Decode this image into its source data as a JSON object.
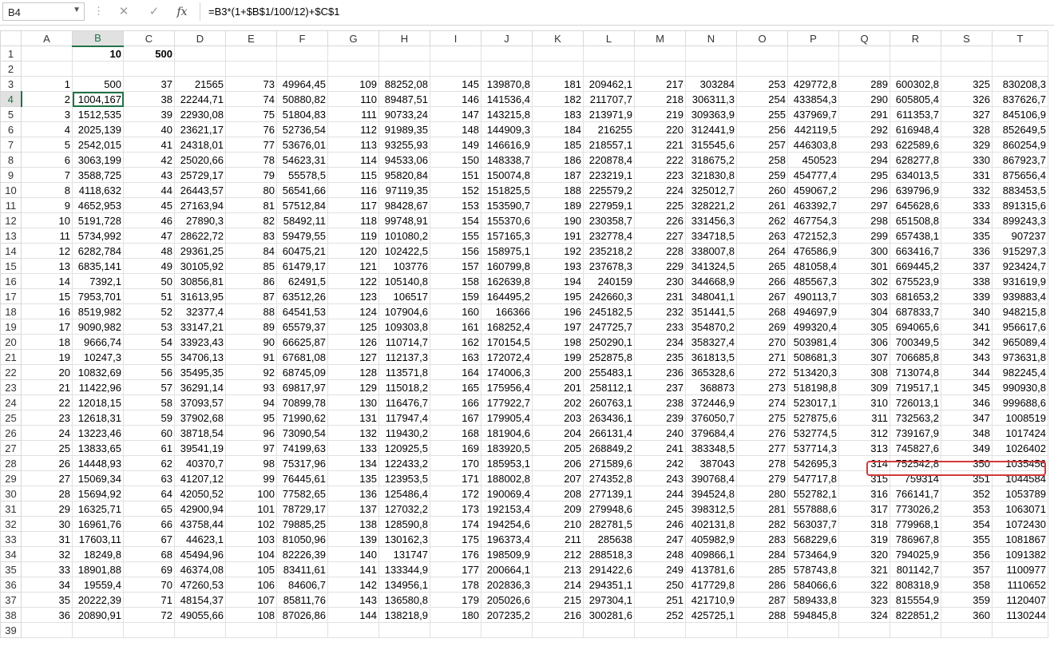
{
  "formula_bar": {
    "name_box": "B4",
    "cancel_glyph": "✕",
    "enter_glyph": "✓",
    "fx_label": "fx",
    "formula": "=B3*(1+$B$1/100/12)+$C$1"
  },
  "sheet": {
    "columns": [
      "A",
      "B",
      "C",
      "D",
      "E",
      "F",
      "G",
      "H",
      "I",
      "J",
      "K",
      "L",
      "M",
      "N",
      "O",
      "P",
      "Q",
      "R",
      "S",
      "T"
    ],
    "active_cell": "B4",
    "highlight": "Q25:T25",
    "rows": [
      {
        "n": "1",
        "cells": [
          "",
          "10",
          "500",
          "",
          "",
          "",
          "",
          "",
          "",
          "",
          "",
          "",
          "",
          "",
          "",
          "",
          "",
          "",
          "",
          ""
        ]
      },
      {
        "n": "2",
        "cells": [
          "",
          "",
          "",
          "",
          "",
          "",
          "",
          "",
          "",
          "",
          "",
          "",
          "",
          "",
          "",
          "",
          "",
          "",
          "",
          ""
        ]
      },
      {
        "n": "3",
        "cells": [
          "1",
          "500",
          "37",
          "21565",
          "73",
          "49964,45",
          "109",
          "88252,08",
          "145",
          "139870,8",
          "181",
          "209462,1",
          "217",
          "303284",
          "253",
          "429772,8",
          "289",
          "600302,8",
          "325",
          "830208,3"
        ]
      },
      {
        "n": "4",
        "cells": [
          "2",
          "1004,167",
          "38",
          "22244,71",
          "74",
          "50880,82",
          "110",
          "89487,51",
          "146",
          "141536,4",
          "182",
          "211707,7",
          "218",
          "306311,3",
          "254",
          "433854,3",
          "290",
          "605805,4",
          "326",
          "837626,7"
        ]
      },
      {
        "n": "5",
        "cells": [
          "3",
          "1512,535",
          "39",
          "22930,08",
          "75",
          "51804,83",
          "111",
          "90733,24",
          "147",
          "143215,8",
          "183",
          "213971,9",
          "219",
          "309363,9",
          "255",
          "437969,7",
          "291",
          "611353,7",
          "327",
          "845106,9"
        ]
      },
      {
        "n": "6",
        "cells": [
          "4",
          "2025,139",
          "40",
          "23621,17",
          "76",
          "52736,54",
          "112",
          "91989,35",
          "148",
          "144909,3",
          "184",
          "216255",
          "220",
          "312441,9",
          "256",
          "442119,5",
          "292",
          "616948,4",
          "328",
          "852649,5"
        ]
      },
      {
        "n": "7",
        "cells": [
          "5",
          "2542,015",
          "41",
          "24318,01",
          "77",
          "53676,01",
          "113",
          "93255,93",
          "149",
          "146616,9",
          "185",
          "218557,1",
          "221",
          "315545,6",
          "257",
          "446303,8",
          "293",
          "622589,6",
          "329",
          "860254,9"
        ]
      },
      {
        "n": "8",
        "cells": [
          "6",
          "3063,199",
          "42",
          "25020,66",
          "78",
          "54623,31",
          "114",
          "94533,06",
          "150",
          "148338,7",
          "186",
          "220878,4",
          "222",
          "318675,2",
          "258",
          "450523",
          "294",
          "628277,8",
          "330",
          "867923,7"
        ]
      },
      {
        "n": "9",
        "cells": [
          "7",
          "3588,725",
          "43",
          "25729,17",
          "79",
          "55578,5",
          "115",
          "95820,84",
          "151",
          "150074,8",
          "187",
          "223219,1",
          "223",
          "321830,8",
          "259",
          "454777,4",
          "295",
          "634013,5",
          "331",
          "875656,4"
        ]
      },
      {
        "n": "10",
        "cells": [
          "8",
          "4118,632",
          "44",
          "26443,57",
          "80",
          "56541,66",
          "116",
          "97119,35",
          "152",
          "151825,5",
          "188",
          "225579,2",
          "224",
          "325012,7",
          "260",
          "459067,2",
          "296",
          "639796,9",
          "332",
          "883453,5"
        ]
      },
      {
        "n": "11",
        "cells": [
          "9",
          "4652,953",
          "45",
          "27163,94",
          "81",
          "57512,84",
          "117",
          "98428,67",
          "153",
          "153590,7",
          "189",
          "227959,1",
          "225",
          "328221,2",
          "261",
          "463392,7",
          "297",
          "645628,6",
          "333",
          "891315,6"
        ]
      },
      {
        "n": "12",
        "cells": [
          "10",
          "5191,728",
          "46",
          "27890,3",
          "82",
          "58492,11",
          "118",
          "99748,91",
          "154",
          "155370,6",
          "190",
          "230358,7",
          "226",
          "331456,3",
          "262",
          "467754,3",
          "298",
          "651508,8",
          "334",
          "899243,3"
        ]
      },
      {
        "n": "13",
        "cells": [
          "11",
          "5734,992",
          "47",
          "28622,72",
          "83",
          "59479,55",
          "119",
          "101080,2",
          "155",
          "157165,3",
          "191",
          "232778,4",
          "227",
          "334718,5",
          "263",
          "472152,3",
          "299",
          "657438,1",
          "335",
          "907237"
        ]
      },
      {
        "n": "14",
        "cells": [
          "12",
          "6282,784",
          "48",
          "29361,25",
          "84",
          "60475,21",
          "120",
          "102422,5",
          "156",
          "158975,1",
          "192",
          "235218,2",
          "228",
          "338007,8",
          "264",
          "476586,9",
          "300",
          "663416,7",
          "336",
          "915297,3"
        ]
      },
      {
        "n": "15",
        "cells": [
          "13",
          "6835,141",
          "49",
          "30105,92",
          "85",
          "61479,17",
          "121",
          "103776",
          "157",
          "160799,8",
          "193",
          "237678,3",
          "229",
          "341324,5",
          "265",
          "481058,4",
          "301",
          "669445,2",
          "337",
          "923424,7"
        ]
      },
      {
        "n": "16",
        "cells": [
          "14",
          "7392,1",
          "50",
          "30856,81",
          "86",
          "62491,5",
          "122",
          "105140,8",
          "158",
          "162639,8",
          "194",
          "240159",
          "230",
          "344668,9",
          "266",
          "485567,3",
          "302",
          "675523,9",
          "338",
          "931619,9"
        ]
      },
      {
        "n": "17",
        "cells": [
          "15",
          "7953,701",
          "51",
          "31613,95",
          "87",
          "63512,26",
          "123",
          "106517",
          "159",
          "164495,2",
          "195",
          "242660,3",
          "231",
          "348041,1",
          "267",
          "490113,7",
          "303",
          "681653,2",
          "339",
          "939883,4"
        ]
      },
      {
        "n": "18",
        "cells": [
          "16",
          "8519,982",
          "52",
          "32377,4",
          "88",
          "64541,53",
          "124",
          "107904,6",
          "160",
          "166366",
          "196",
          "245182,5",
          "232",
          "351441,5",
          "268",
          "494697,9",
          "304",
          "687833,7",
          "340",
          "948215,8"
        ]
      },
      {
        "n": "19",
        "cells": [
          "17",
          "9090,982",
          "53",
          "33147,21",
          "89",
          "65579,37",
          "125",
          "109303,8",
          "161",
          "168252,4",
          "197",
          "247725,7",
          "233",
          "354870,2",
          "269",
          "499320,4",
          "305",
          "694065,6",
          "341",
          "956617,6"
        ]
      },
      {
        "n": "20",
        "cells": [
          "18",
          "9666,74",
          "54",
          "33923,43",
          "90",
          "66625,87",
          "126",
          "110714,7",
          "162",
          "170154,5",
          "198",
          "250290,1",
          "234",
          "358327,4",
          "270",
          "503981,4",
          "306",
          "700349,5",
          "342",
          "965089,4"
        ]
      },
      {
        "n": "21",
        "cells": [
          "19",
          "10247,3",
          "55",
          "34706,13",
          "91",
          "67681,08",
          "127",
          "112137,3",
          "163",
          "172072,4",
          "199",
          "252875,8",
          "235",
          "361813,5",
          "271",
          "508681,3",
          "307",
          "706685,8",
          "343",
          "973631,8"
        ]
      },
      {
        "n": "22",
        "cells": [
          "20",
          "10832,69",
          "56",
          "35495,35",
          "92",
          "68745,09",
          "128",
          "113571,8",
          "164",
          "174006,3",
          "200",
          "255483,1",
          "236",
          "365328,6",
          "272",
          "513420,3",
          "308",
          "713074,8",
          "344",
          "982245,4"
        ]
      },
      {
        "n": "23",
        "cells": [
          "21",
          "11422,96",
          "57",
          "36291,14",
          "93",
          "69817,97",
          "129",
          "115018,2",
          "165",
          "175956,4",
          "201",
          "258112,1",
          "237",
          "368873",
          "273",
          "518198,8",
          "309",
          "719517,1",
          "345",
          "990930,8"
        ]
      },
      {
        "n": "24",
        "cells": [
          "22",
          "12018,15",
          "58",
          "37093,57",
          "94",
          "70899,78",
          "130",
          "116476,7",
          "166",
          "177922,7",
          "202",
          "260763,1",
          "238",
          "372446,9",
          "274",
          "523017,1",
          "310",
          "726013,1",
          "346",
          "999688,6"
        ]
      },
      {
        "n": "25",
        "cells": [
          "23",
          "12618,31",
          "59",
          "37902,68",
          "95",
          "71990,62",
          "131",
          "117947,4",
          "167",
          "179905,4",
          "203",
          "263436,1",
          "239",
          "376050,7",
          "275",
          "527875,6",
          "311",
          "732563,2",
          "347",
          "1008519"
        ]
      },
      {
        "n": "26",
        "cells": [
          "24",
          "13223,46",
          "60",
          "38718,54",
          "96",
          "73090,54",
          "132",
          "119430,2",
          "168",
          "181904,6",
          "204",
          "266131,4",
          "240",
          "379684,4",
          "276",
          "532774,5",
          "312",
          "739167,9",
          "348",
          "1017424"
        ]
      },
      {
        "n": "27",
        "cells": [
          "25",
          "13833,65",
          "61",
          "39541,19",
          "97",
          "74199,63",
          "133",
          "120925,5",
          "169",
          "183920,5",
          "205",
          "268849,2",
          "241",
          "383348,5",
          "277",
          "537714,3",
          "313",
          "745827,6",
          "349",
          "1026402"
        ]
      },
      {
        "n": "28",
        "cells": [
          "26",
          "14448,93",
          "62",
          "40370,7",
          "98",
          "75317,96",
          "134",
          "122433,2",
          "170",
          "185953,1",
          "206",
          "271589,6",
          "242",
          "387043",
          "278",
          "542695,3",
          "314",
          "752542,8",
          "350",
          "1035456"
        ]
      },
      {
        "n": "29",
        "cells": [
          "27",
          "15069,34",
          "63",
          "41207,12",
          "99",
          "76445,61",
          "135",
          "123953,5",
          "171",
          "188002,8",
          "207",
          "274352,8",
          "243",
          "390768,4",
          "279",
          "547717,8",
          "315",
          "759314",
          "351",
          "1044584"
        ]
      },
      {
        "n": "30",
        "cells": [
          "28",
          "15694,92",
          "64",
          "42050,52",
          "100",
          "77582,65",
          "136",
          "125486,4",
          "172",
          "190069,4",
          "208",
          "277139,1",
          "244",
          "394524,8",
          "280",
          "552782,1",
          "316",
          "766141,7",
          "352",
          "1053789"
        ]
      },
      {
        "n": "31",
        "cells": [
          "29",
          "16325,71",
          "65",
          "42900,94",
          "101",
          "78729,17",
          "137",
          "127032,2",
          "173",
          "192153,4",
          "209",
          "279948,6",
          "245",
          "398312,5",
          "281",
          "557888,6",
          "317",
          "773026,2",
          "353",
          "1063071"
        ]
      },
      {
        "n": "32",
        "cells": [
          "30",
          "16961,76",
          "66",
          "43758,44",
          "102",
          "79885,25",
          "138",
          "128590,8",
          "174",
          "194254,6",
          "210",
          "282781,5",
          "246",
          "402131,8",
          "282",
          "563037,7",
          "318",
          "779968,1",
          "354",
          "1072430"
        ]
      },
      {
        "n": "33",
        "cells": [
          "31",
          "17603,11",
          "67",
          "44623,1",
          "103",
          "81050,96",
          "139",
          "130162,3",
          "175",
          "196373,4",
          "211",
          "285638",
          "247",
          "405982,9",
          "283",
          "568229,6",
          "319",
          "786967,8",
          "355",
          "1081867"
        ]
      },
      {
        "n": "34",
        "cells": [
          "32",
          "18249,8",
          "68",
          "45494,96",
          "104",
          "82226,39",
          "140",
          "131747",
          "176",
          "198509,9",
          "212",
          "288518,3",
          "248",
          "409866,1",
          "284",
          "573464,9",
          "320",
          "794025,9",
          "356",
          "1091382"
        ]
      },
      {
        "n": "35",
        "cells": [
          "33",
          "18901,88",
          "69",
          "46374,08",
          "105",
          "83411,61",
          "141",
          "133344,9",
          "177",
          "200664,1",
          "213",
          "291422,6",
          "249",
          "413781,6",
          "285",
          "578743,8",
          "321",
          "801142,7",
          "357",
          "1100977"
        ]
      },
      {
        "n": "36",
        "cells": [
          "34",
          "19559,4",
          "70",
          "47260,53",
          "106",
          "84606,7",
          "142",
          "134956,1",
          "178",
          "202836,3",
          "214",
          "294351,1",
          "250",
          "417729,8",
          "286",
          "584066,6",
          "322",
          "808318,9",
          "358",
          "1110652"
        ]
      },
      {
        "n": "37",
        "cells": [
          "35",
          "20222,39",
          "71",
          "48154,37",
          "107",
          "85811,76",
          "143",
          "136580,8",
          "179",
          "205026,6",
          "215",
          "297304,1",
          "251",
          "421710,9",
          "287",
          "589433,8",
          "323",
          "815554,9",
          "359",
          "1120407"
        ]
      },
      {
        "n": "38",
        "cells": [
          "36",
          "20890,91",
          "72",
          "49055,66",
          "108",
          "87026,86",
          "144",
          "138218,9",
          "180",
          "207235,2",
          "216",
          "300281,6",
          "252",
          "425725,1",
          "288",
          "594845,8",
          "324",
          "822851,2",
          "360",
          "1130244"
        ]
      },
      {
        "n": "39",
        "cells": [
          "",
          "",
          "",
          "",
          "",
          "",
          "",
          "",
          "",
          "",
          "",
          "",
          "",
          "",
          "",
          "",
          "",
          "",
          "",
          ""
        ]
      }
    ]
  }
}
